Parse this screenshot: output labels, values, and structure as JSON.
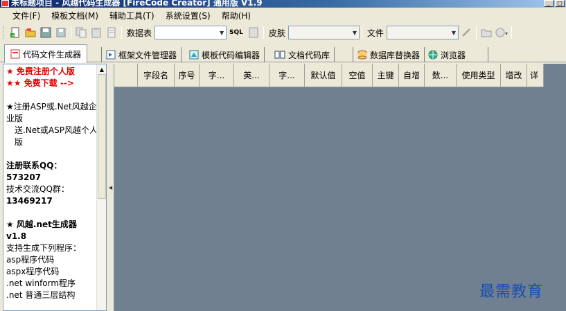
{
  "window": {
    "title": "未标题项目 - 风越代码生成器 [FireCode Creator] 通用版 V1.9"
  },
  "menu": [
    {
      "label": "文件(F)"
    },
    {
      "label": "模板文档(M)"
    },
    {
      "label": "辅助工具(T)"
    },
    {
      "label": "系统设置(S)"
    },
    {
      "label": "帮助(H)"
    }
  ],
  "toolbar": {
    "table_label": "数据表",
    "sql_label": "SQL",
    "skin_label": "皮肤",
    "file_label": "文件"
  },
  "tabs": [
    {
      "label": "代码文件生成器",
      "icon": "code-file-icon"
    },
    {
      "label": "框架文件管理器",
      "icon": "framework-file-icon"
    },
    {
      "label": "模板代码编辑器",
      "icon": "template-editor-icon"
    },
    {
      "label": "文档代码库",
      "icon": "book-icon"
    },
    {
      "label": "数据库替换器",
      "icon": "database-icon"
    },
    {
      "label": "浏览器",
      "icon": "globe-icon"
    }
  ],
  "left_panel": {
    "promo1": "★ 免费注册个人版",
    "promo2": "★★ 免费下载 -->",
    "reg_offer_1": "★注册ASP或.Net风越企业版",
    "reg_offer_2": "送.Net或ASP风越个人版",
    "contact_qq_label": "注册联系QQ：",
    "contact_qq": "573207",
    "group_label": "技术交流QQ群：",
    "group_qq": "13469217",
    "product_title": "★ 风越.net生成器",
    "product_version": "v1.8",
    "support_label": "支持生成下列程序：",
    "support_items": [
      "asp程序代码",
      "aspx程序代码",
      ".net winform程序",
      ".net 普通三层结构"
    ]
  },
  "grid": {
    "columns": [
      "字段名",
      "序号",
      "字...",
      "英...",
      "字...",
      "默认值",
      "空值",
      "主键",
      "自增",
      "数...",
      "使用类型",
      "增改",
      "详"
    ]
  },
  "watermark": "最需教育"
}
